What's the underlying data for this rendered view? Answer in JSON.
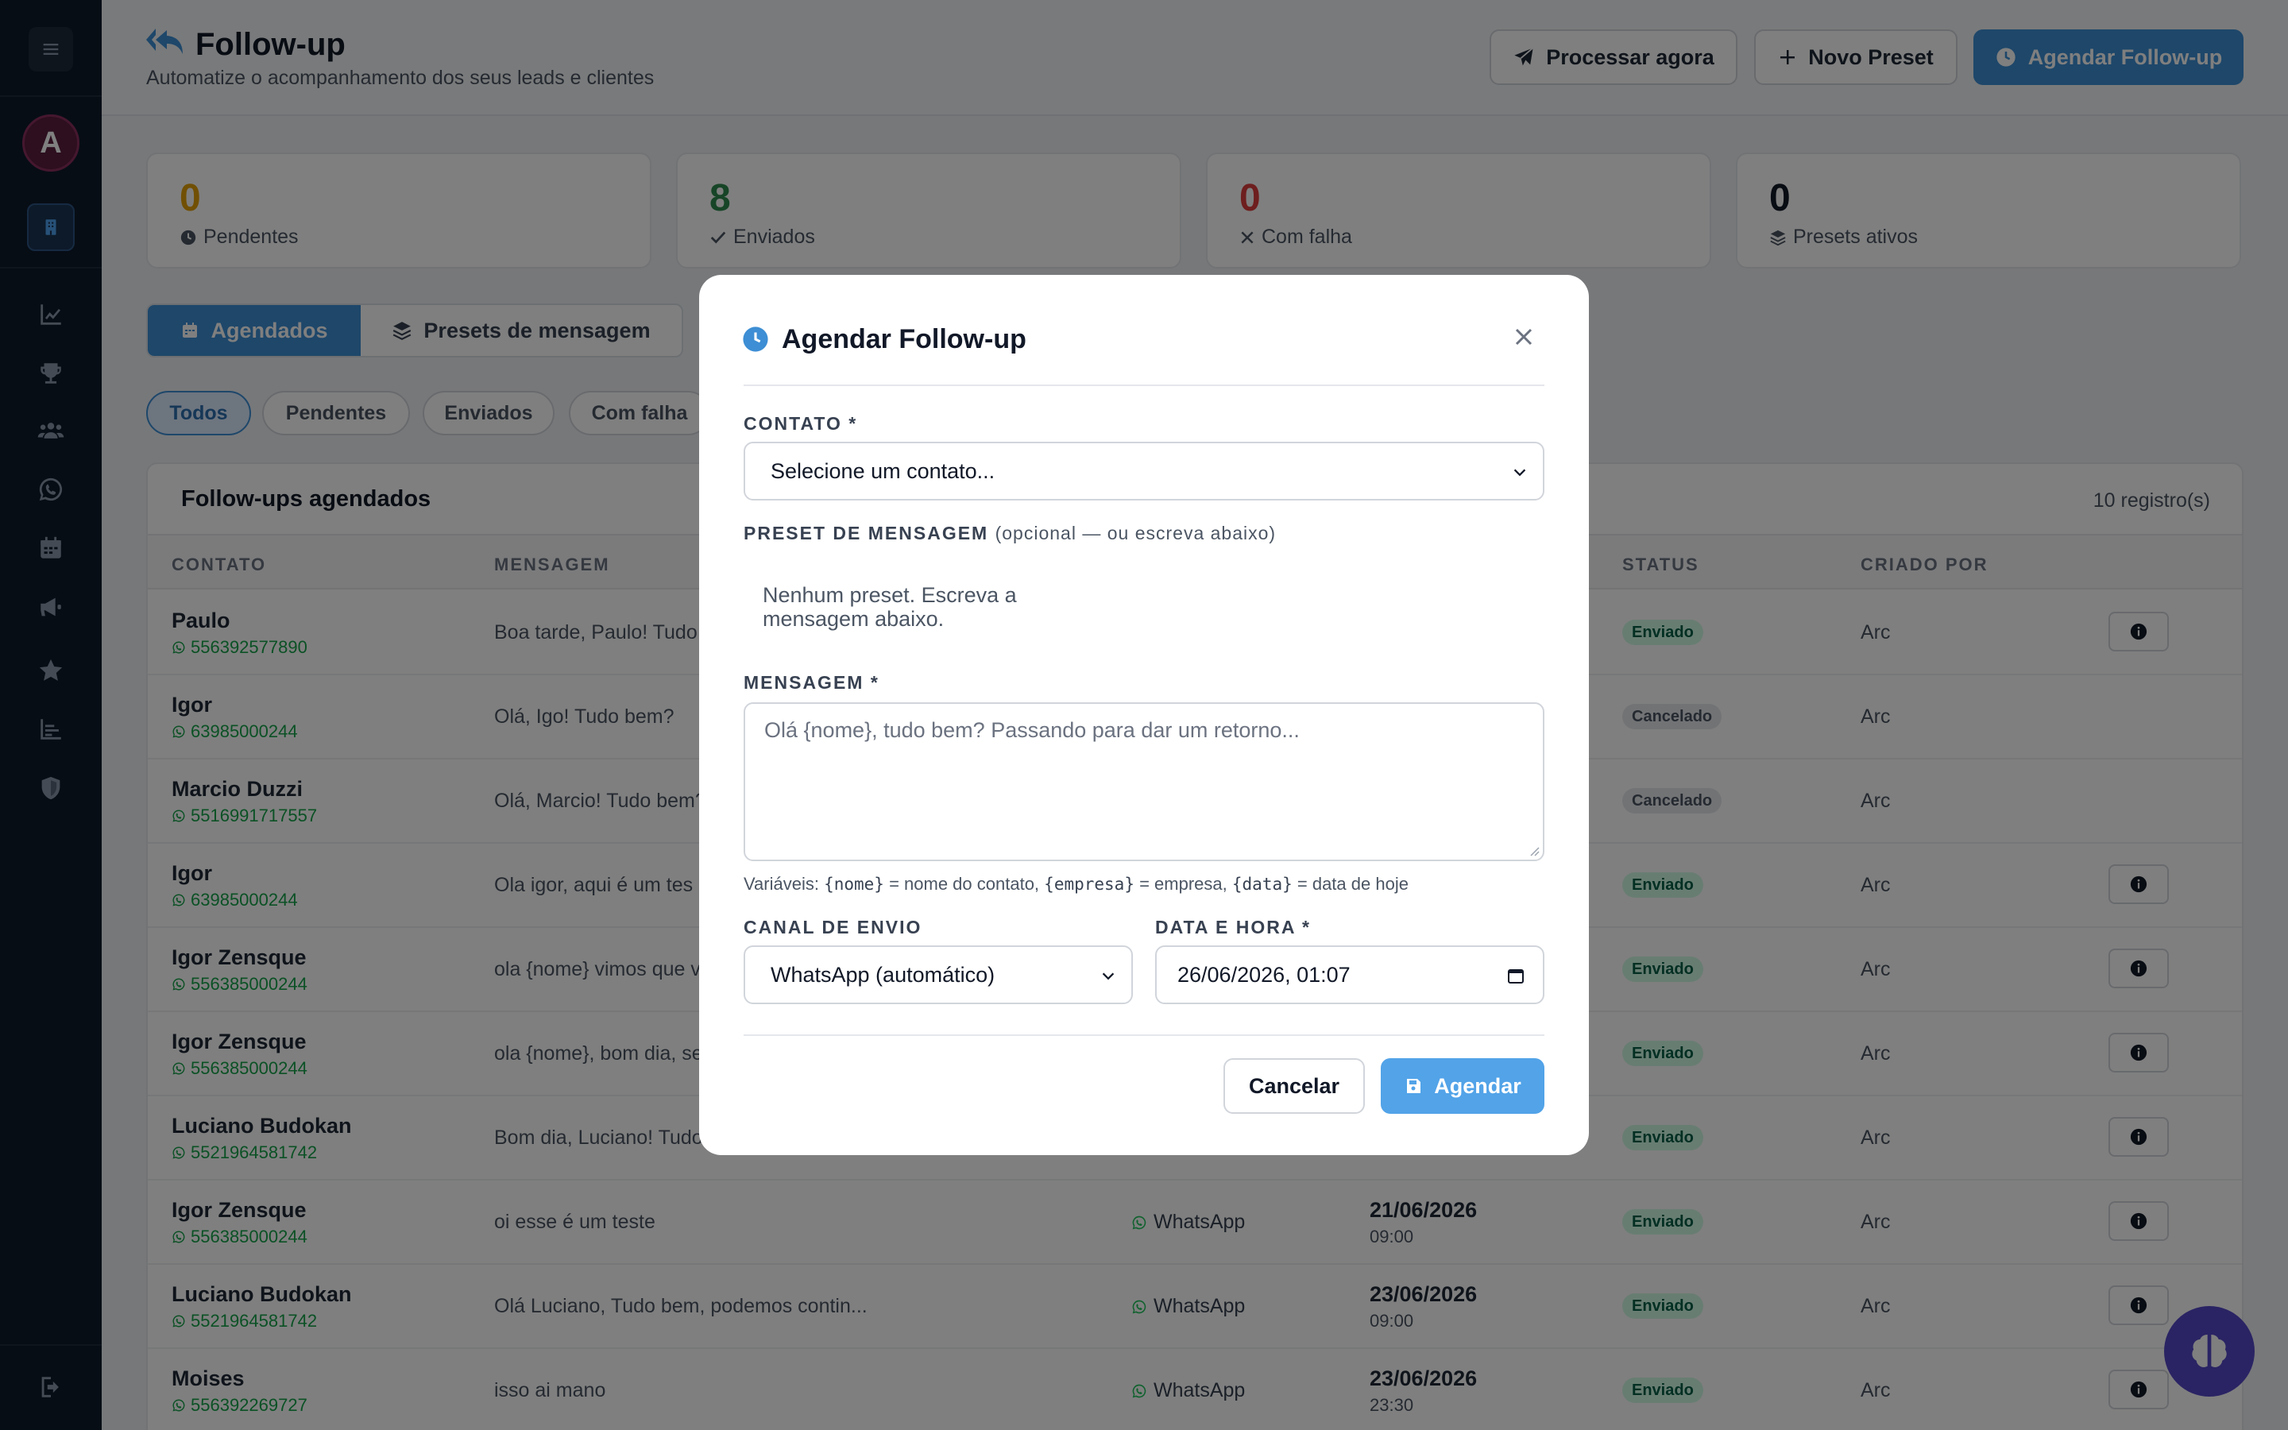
{
  "header": {
    "title": "Follow-up",
    "subtitle": "Automatize o acompanhamento dos seus leads e clientes",
    "btn_process": "Processar agora",
    "btn_new_preset": "Novo Preset",
    "btn_schedule": "Agendar Follow-up",
    "accent": "#3d8ed4"
  },
  "sidebar": {
    "avatar_letter": "A",
    "avatar_color": "#5a1e3f",
    "icons": [
      "menu-icon",
      "building-icon",
      "chart-line-icon",
      "trophy-icon",
      "users-icon",
      "whatsapp-icon",
      "calendar-icon",
      "megaphone-icon",
      "star-icon",
      "bar-chart-icon",
      "shield-icon",
      "logout-icon"
    ]
  },
  "stats": [
    {
      "value": "0",
      "label": "Pendentes",
      "color": "#e3a008",
      "icon": "clock-icon"
    },
    {
      "value": "8",
      "label": "Enviados",
      "color": "#2f8a4f",
      "icon": "check-icon"
    },
    {
      "value": "0",
      "label": "Com falha",
      "color": "#dc3d3d",
      "icon": "x-icon"
    },
    {
      "value": "0",
      "label": "Presets ativos",
      "color": "#111827",
      "icon": "layers-icon"
    }
  ],
  "tabs": {
    "scheduled": "Agendados",
    "presets": "Presets de mensagem"
  },
  "filters": [
    "Todos",
    "Pendentes",
    "Enviados",
    "Com falha"
  ],
  "table": {
    "title": "Follow-ups agendados",
    "count": "10 registro(s)",
    "columns": {
      "contact": "CONTATO",
      "message": "MENSAGEM",
      "status": "STATUS",
      "created_by": "CRIADO POR"
    },
    "rows": [
      {
        "name": "Paulo",
        "phone": "556392577890",
        "message": "Boa tarde, Paulo! Tudo",
        "channel": "",
        "date": "",
        "time": "",
        "status": "Enviado",
        "by": "Arc"
      },
      {
        "name": "Igor",
        "phone": "63985000244",
        "message": "Olá, Igo! Tudo bem?",
        "channel": "",
        "date": "",
        "time": "",
        "status": "Cancelado",
        "by": "Arc"
      },
      {
        "name": "Marcio Duzzi",
        "phone": "5516991717557",
        "message": "Olá, Marcio! Tudo bem?",
        "channel": "",
        "date": "",
        "time": "",
        "status": "Cancelado",
        "by": "Arc"
      },
      {
        "name": "Igor",
        "phone": "63985000244",
        "message": "Ola igor, aqui é um tes",
        "channel": "",
        "date": "",
        "time": "",
        "status": "Enviado",
        "by": "Arc"
      },
      {
        "name": "Igor Zensque",
        "phone": "556385000244",
        "message": "ola {nome} vimos que v",
        "channel": "",
        "date": "",
        "time": "",
        "status": "Enviado",
        "by": "Arc"
      },
      {
        "name": "Igor Zensque",
        "phone": "556385000244",
        "message": "ola {nome}, bom dia, se",
        "channel": "",
        "date": "",
        "time": "",
        "status": "Enviado",
        "by": "Arc"
      },
      {
        "name": "Luciano Budokan",
        "phone": "5521964581742",
        "message": "Bom dia, Luciano! Tudo",
        "channel": "",
        "date": "",
        "time": "",
        "status": "Enviado",
        "by": "Arc"
      },
      {
        "name": "Igor Zensque",
        "phone": "556385000244",
        "message": "oi esse é um teste",
        "channel": "WhatsApp",
        "date": "21/06/2026",
        "time": "09:00",
        "status": "Enviado",
        "by": "Arc"
      },
      {
        "name": "Luciano Budokan",
        "phone": "5521964581742",
        "message": "Olá Luciano, Tudo bem, podemos contin...",
        "channel": "WhatsApp",
        "date": "23/06/2026",
        "time": "09:00",
        "status": "Enviado",
        "by": "Arc"
      },
      {
        "name": "Moises",
        "phone": "556392269727",
        "message": "isso ai mano",
        "channel": "WhatsApp",
        "date": "23/06/2026",
        "time": "23:30",
        "status": "Enviado",
        "by": "Arc"
      }
    ]
  },
  "modal": {
    "title": "Agendar Follow-up",
    "contact_label": "CONTATO *",
    "contact_value": "Selecione um contato...",
    "preset_label": "PRESET DE MENSAGEM",
    "preset_optional": "(opcional — ou escreva abaixo)",
    "preset_empty": "Nenhum preset. Escreva a mensagem abaixo.",
    "message_label": "MENSAGEM *",
    "message_placeholder": "Olá {nome}, tudo bem? Passando para dar um retorno...",
    "hint_prefix": "Variáveis:",
    "hint_var1": "{nome}",
    "hint_txt1": "= nome do contato,",
    "hint_var2": "{empresa}",
    "hint_txt2": "= empresa,",
    "hint_var3": "{data}",
    "hint_txt3": "= data de hoje",
    "channel_label": "CANAL DE ENVIO",
    "channel_value": "WhatsApp (automático)",
    "datetime_label": "DATA E HORA *",
    "datetime_value": "26/06/2026, 01:07",
    "cancel": "Cancelar",
    "submit": "Agendar"
  }
}
